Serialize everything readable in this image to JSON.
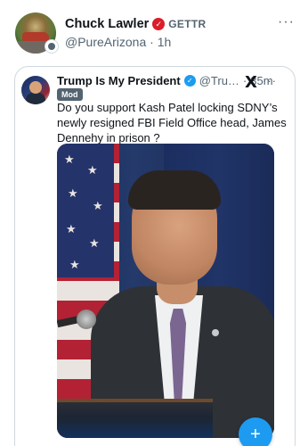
{
  "post": {
    "author_name": "Chuck Lawler",
    "platform_label": "GETTR",
    "handle": "@PureArizona",
    "separator": "·",
    "time": "1h",
    "more": "···"
  },
  "quote": {
    "author_name": "Trump Is My President",
    "handle": "@Tru…",
    "separator": "·",
    "time": "35m",
    "more": "···",
    "badge": "Mod",
    "text": "Do you support Kash Patel locking SDNY’s newly resigned FBI Field Office head, James Dennehy in prison ?"
  },
  "icons": {
    "verified": "verified-check-icon",
    "red_badge": "gettr-check-icon",
    "x_logo": "x-logo-icon",
    "compose": "compose-plus-icon"
  },
  "colors": {
    "accent": "#1d9bf0",
    "secondary_text": "#536471",
    "gettr_red": "#d91f2b"
  }
}
